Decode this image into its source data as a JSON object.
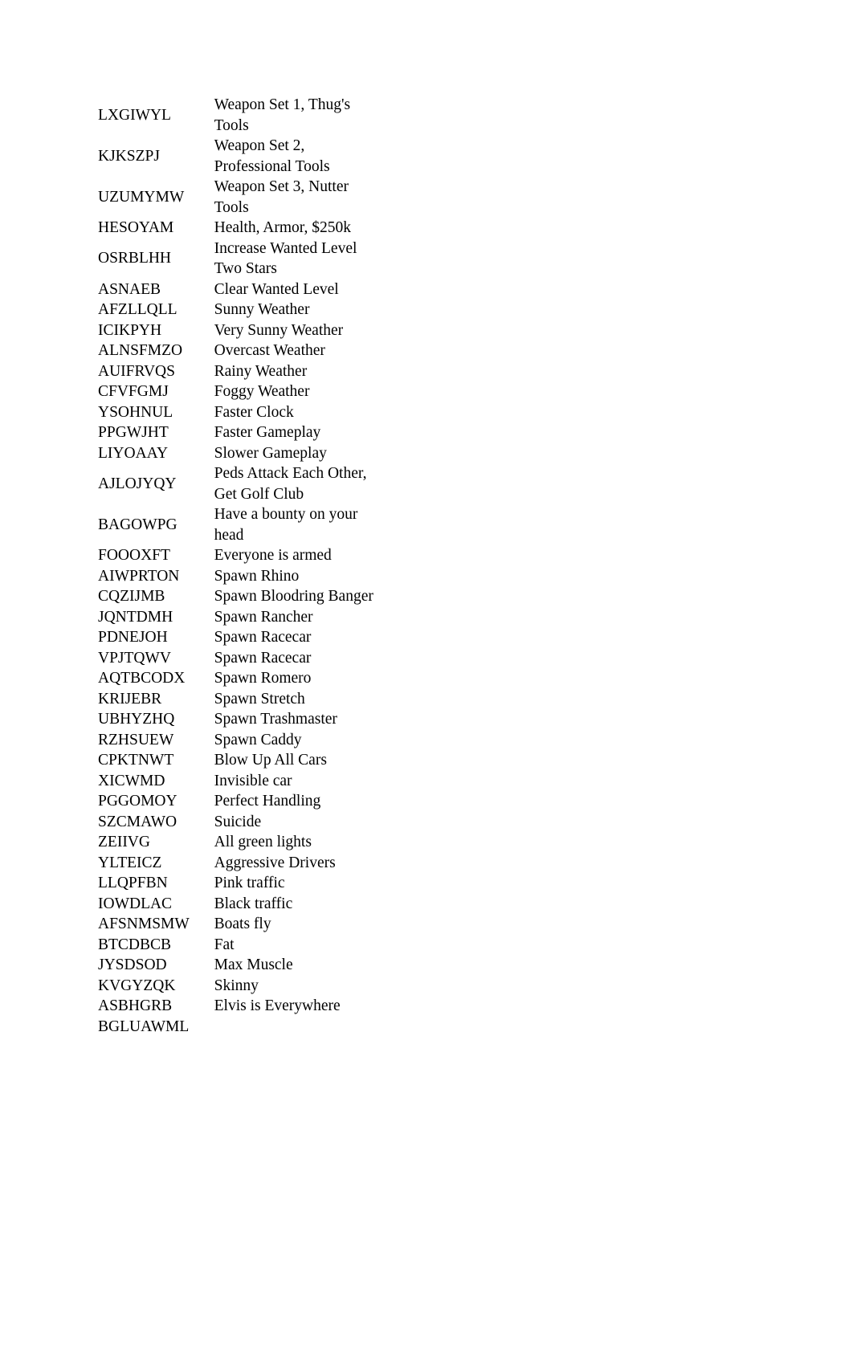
{
  "document": {
    "background_color": "#ffffff",
    "text_color": "#000000",
    "blurred_text_color": "#4a4a4a"
  },
  "left_table": {
    "rows": [
      {
        "code": "LXGIWYL",
        "description": "Weapon Set 1, Thug's Tools"
      },
      {
        "code": "KJKSZPJ",
        "description": "Weapon Set 2, Professional Tools"
      },
      {
        "code": "UZUMYMW",
        "description": "Weapon Set 3, Nutter Tools"
      },
      {
        "code": "HESOYAM",
        "description": "Health, Armor, $250k"
      },
      {
        "code": "OSRBLHH",
        "description": "Increase Wanted Level Two Stars"
      },
      {
        "code": "ASNAEB",
        "description": "Clear Wanted Level"
      },
      {
        "code": "AFZLLQLL",
        "description": "Sunny Weather"
      },
      {
        "code": "ICIKPYH",
        "description": "Very Sunny Weather"
      },
      {
        "code": "ALNSFMZO",
        "description": "Overcast Weather"
      },
      {
        "code": "AUIFRVQS",
        "description": "Rainy Weather"
      },
      {
        "code": "CFVFGMJ",
        "description": "Foggy Weather"
      },
      {
        "code": "YSOHNUL",
        "description": "Faster Clock"
      },
      {
        "code": "PPGWJHT",
        "description": "Faster Gameplay"
      },
      {
        "code": "LIYOAAY",
        "description": "Slower Gameplay"
      },
      {
        "code": "AJLOJYQY",
        "description": "Peds Attack Each Other, Get Golf Club"
      },
      {
        "code": "BAGOWPG",
        "description": "Have a bounty on your head"
      },
      {
        "code": "FOOOXFT",
        "description": "Everyone is armed"
      },
      {
        "code": "AIWPRTON",
        "description": "Spawn Rhino"
      },
      {
        "code": "CQZIJMB",
        "description": "Spawn Bloodring Banger"
      },
      {
        "code": "JQNTDMH",
        "description": "Spawn Rancher"
      },
      {
        "code": "PDNEJOH",
        "description": "Spawn Racecar"
      },
      {
        "code": "VPJTQWV",
        "description": "Spawn Racecar"
      },
      {
        "code": "AQTBCODX",
        "description": "Spawn Romero"
      },
      {
        "code": "KRIJEBR",
        "description": "Spawn Stretch"
      },
      {
        "code": "UBHYZHQ",
        "description": "Spawn Trashmaster"
      },
      {
        "code": "RZHSUEW",
        "description": "Spawn Caddy"
      },
      {
        "code": "CPKTNWT",
        "description": "Blow Up All Cars"
      },
      {
        "code": "XICWMD",
        "description": "Invisible car"
      },
      {
        "code": "PGGOMOY",
        "description": "Perfect Handling"
      },
      {
        "code": "SZCMAWO",
        "description": "Suicide"
      },
      {
        "code": "ZEIIVG",
        "description": "All green lights"
      },
      {
        "code": "YLTEICZ",
        "description": "Aggressive Drivers"
      },
      {
        "code": "LLQPFBN",
        "description": "Pink traffic"
      },
      {
        "code": "IOWDLAC",
        "description": "Black traffic"
      },
      {
        "code": "AFSNMSMW",
        "description": "Boats fly"
      },
      {
        "code": "BTCDBCB",
        "description": "Fat"
      },
      {
        "code": "JYSDSOD",
        "description": "Max Muscle"
      },
      {
        "code": "KVGYZQK",
        "description": "Skinny"
      },
      {
        "code": "ASBHGRB",
        "description": "Elvis is Everywhere"
      },
      {
        "code": "BGLUAWML",
        "description": ""
      }
    ]
  },
  "right_table": {
    "note": "Second code/description column rendered blurred and illegible in the source image.",
    "rows": [
      {
        "code": "",
        "description": ""
      },
      {
        "code": "",
        "description": ""
      },
      {
        "code": "",
        "description": ""
      },
      {
        "code": "",
        "description": ""
      },
      {
        "code": "",
        "description": ""
      },
      {
        "code": "",
        "description": ""
      },
      {
        "code": "",
        "description": ""
      },
      {
        "code": "",
        "description": ""
      },
      {
        "code": "",
        "description": ""
      },
      {
        "code": "",
        "description": ""
      },
      {
        "code": "",
        "description": ""
      },
      {
        "code": "",
        "description": ""
      },
      {
        "code": "",
        "description": ""
      },
      {
        "code": "",
        "description": ""
      },
      {
        "code": "",
        "description": ""
      },
      {
        "code": "",
        "description": ""
      },
      {
        "code": "",
        "description": ""
      },
      {
        "code": "",
        "description": ""
      },
      {
        "code": "",
        "description": ""
      },
      {
        "code": "",
        "description": ""
      },
      {
        "code": "",
        "description": ""
      },
      {
        "code": "",
        "description": ""
      },
      {
        "code": "",
        "description": ""
      },
      {
        "code": "",
        "description": ""
      },
      {
        "code": "",
        "description": ""
      },
      {
        "code": "",
        "description": ""
      },
      {
        "code": "",
        "description": ""
      },
      {
        "code": "",
        "description": ""
      },
      {
        "code": "",
        "description": ""
      },
      {
        "code": "",
        "description": ""
      },
      {
        "code": "",
        "description": ""
      },
      {
        "code": "",
        "description": ""
      },
      {
        "code": "",
        "description": ""
      },
      {
        "code": "",
        "description": ""
      },
      {
        "code": "",
        "description": ""
      },
      {
        "code": "",
        "description": ""
      },
      {
        "code": "",
        "description": ""
      },
      {
        "code": "",
        "description": ""
      },
      {
        "code": "",
        "description": ""
      },
      {
        "code": "",
        "description": ""
      }
    ]
  }
}
